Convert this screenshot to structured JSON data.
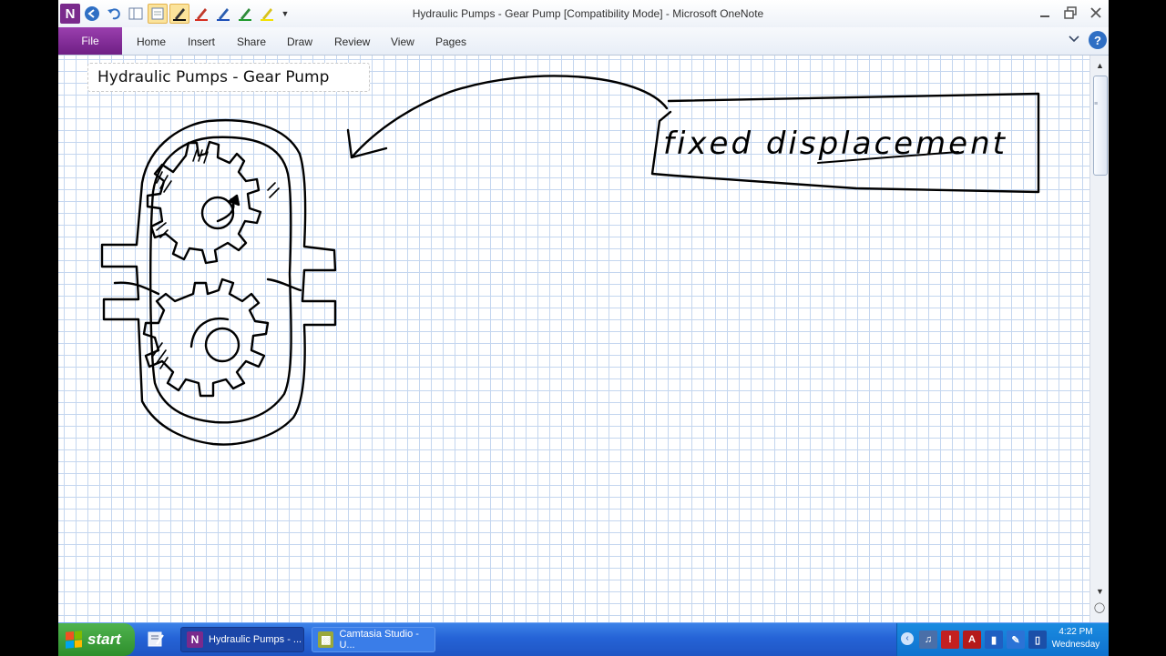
{
  "window": {
    "title": "Hydraulic Pumps - Gear Pump [Compatibility Mode]  -  Microsoft OneNote",
    "logo_letter": "N"
  },
  "ribbon": {
    "file_tab": "File",
    "tabs": [
      "Home",
      "Insert",
      "Share",
      "Draw",
      "Review",
      "View",
      "Pages"
    ]
  },
  "page": {
    "title": "Hydraulic Pumps - Gear Pump",
    "ink_text": "fixed displacement"
  },
  "taskbar": {
    "start_label": "start",
    "tasks": [
      {
        "label": "Hydraulic Pumps - ...",
        "icon": "onenote-icon"
      },
      {
        "label": "Camtasia Studio - U...",
        "icon": "camtasia-icon"
      }
    ],
    "clock_time": "4:22 PM",
    "clock_day": "Wednesday"
  },
  "colors": {
    "onenote_purple": "#7a2a8c",
    "grid_line": "#c4d6ef",
    "taskbar_blue": "#2563d6",
    "start_green": "#3a9f38"
  }
}
